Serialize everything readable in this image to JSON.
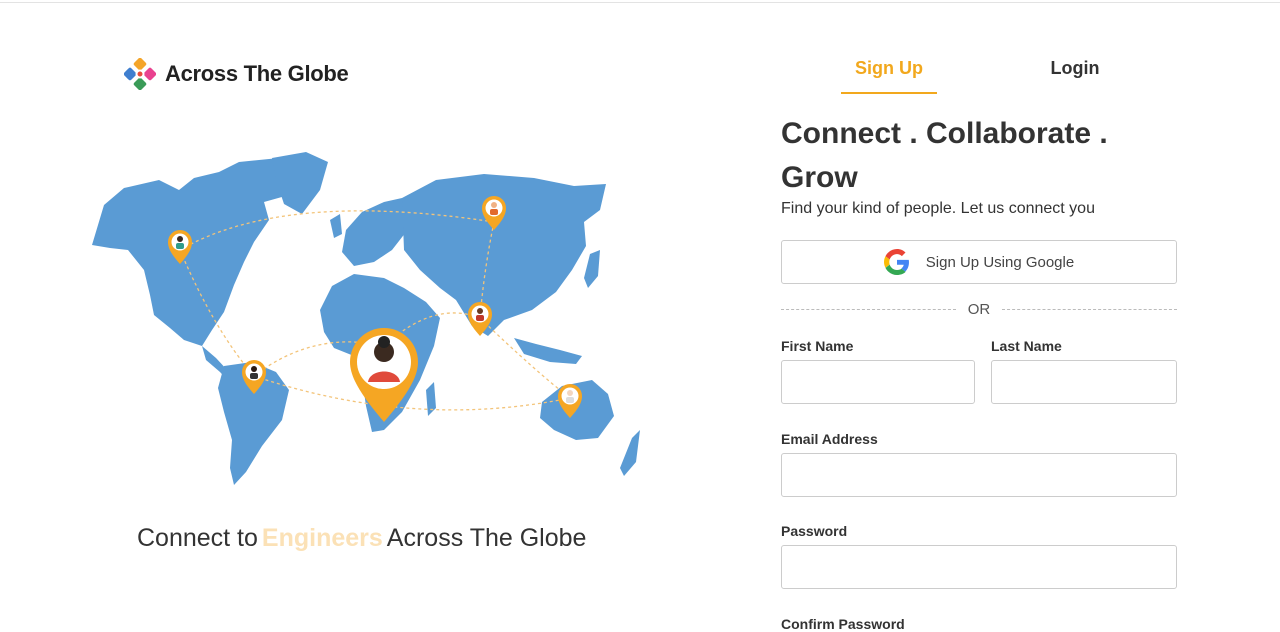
{
  "brand": {
    "name": "Across The Globe",
    "logo_icon": "four-petal-logo"
  },
  "hero": {
    "tagline_prefix": "Connect to",
    "tagline_highlight": "Engineers",
    "tagline_suffix": "Across The Globe",
    "map_image": "world-map-with-people-pins"
  },
  "tabs": [
    {
      "label": "Sign Up",
      "active": true
    },
    {
      "label": "Login",
      "active": false
    }
  ],
  "signup": {
    "headline": "Connect . Collaborate . Grow",
    "subhead": "Find your kind of people. Let us connect you",
    "google_button": "Sign Up Using Google",
    "or": "OR",
    "fields": {
      "first_name": {
        "label": "First Name",
        "value": ""
      },
      "last_name": {
        "label": "Last Name",
        "value": ""
      },
      "email": {
        "label": "Email Address",
        "value": ""
      },
      "password": {
        "label": "Password",
        "value": ""
      },
      "confirm_password": {
        "label": "Confirm Password"
      }
    }
  },
  "colors": {
    "accent": "#f2a81d",
    "map": "#5a9bd4",
    "pin": "#f5a623",
    "highlight": "#fbe1b6"
  }
}
